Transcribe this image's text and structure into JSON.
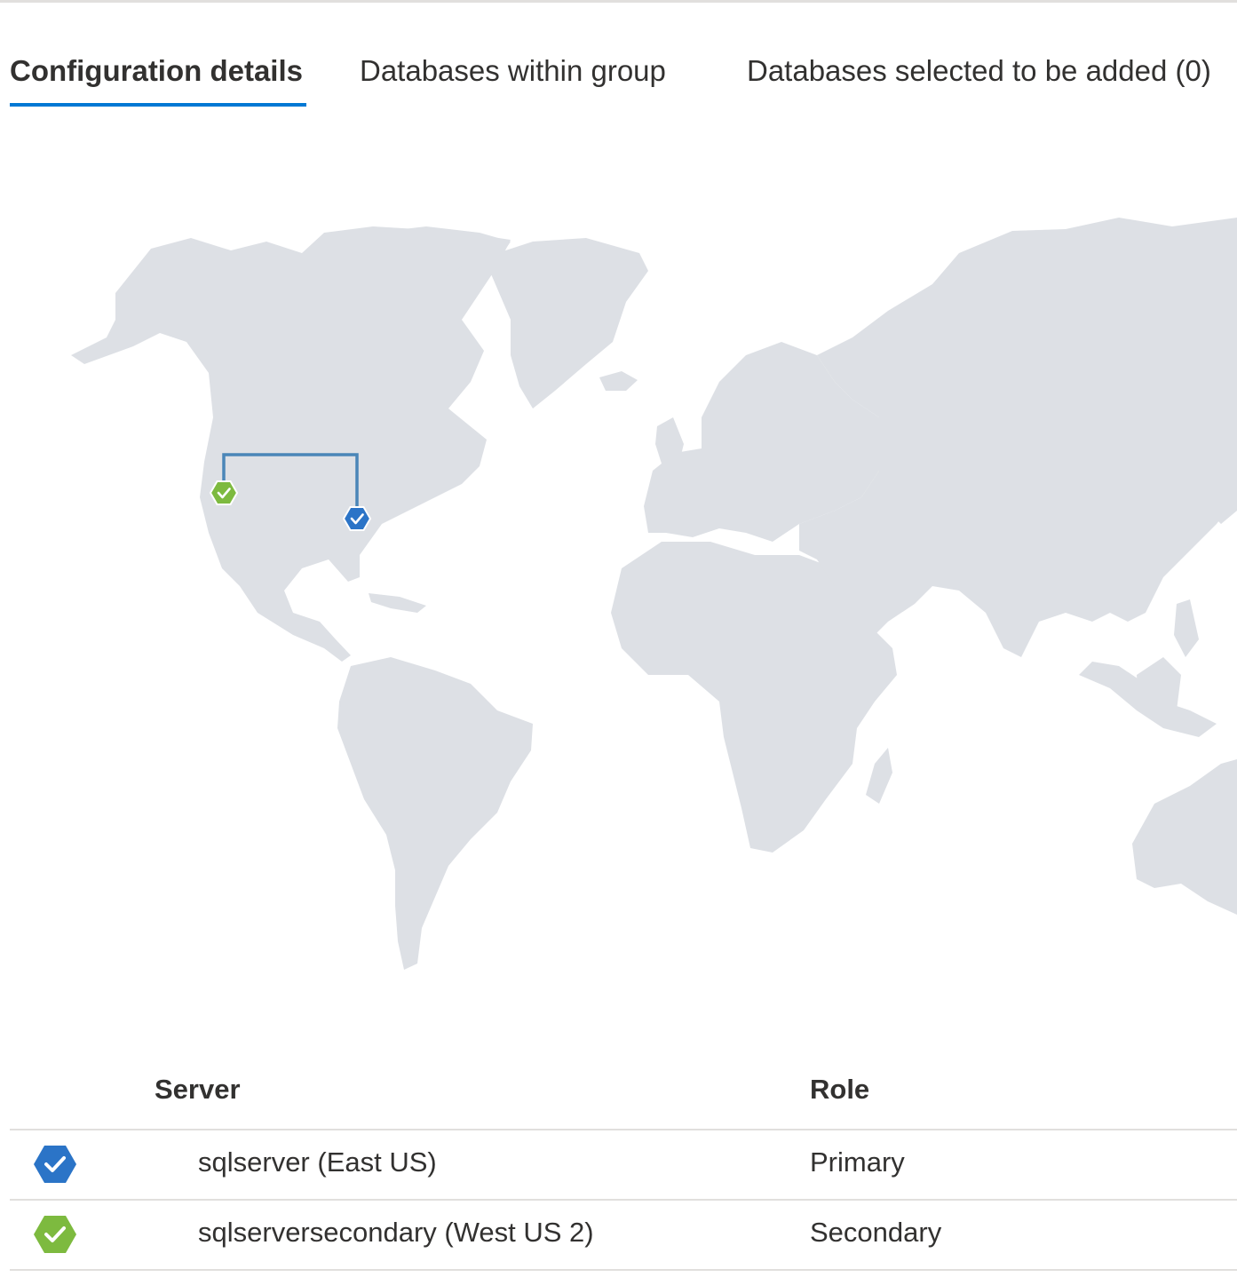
{
  "tabs": [
    {
      "label": "Configuration details",
      "active": true
    },
    {
      "label": "Databases within group",
      "active": false
    },
    {
      "label": "Databases selected to be added (0)",
      "active": false
    }
  ],
  "map": {
    "primary_marker": {
      "icon": "blue-hexagon-check-icon",
      "color": "#2b74c7"
    },
    "secondary_marker": {
      "icon": "green-hexagon-check-icon",
      "color": "#7dba3f"
    },
    "link_color": "#4a86b8",
    "land_color": "#dde0e5"
  },
  "table": {
    "headers": {
      "server": "Server",
      "role": "Role"
    },
    "rows": [
      {
        "status_icon": "blue-hexagon-check-icon",
        "status_color": "#2b74c7",
        "server": "sqlserver (East US)",
        "role": "Primary"
      },
      {
        "status_icon": "green-hexagon-check-icon",
        "status_color": "#7dba3f",
        "server": "sqlserversecondary (West US 2)",
        "role": "Secondary"
      }
    ]
  }
}
